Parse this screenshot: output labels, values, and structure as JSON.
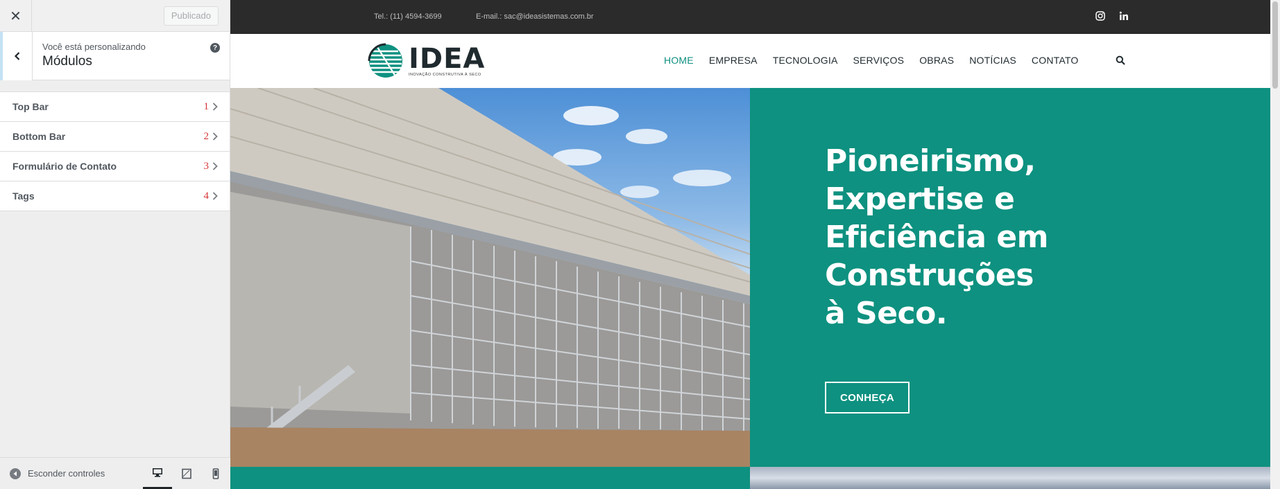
{
  "customizer": {
    "close_glyph": "✕",
    "publish_label": "Publicado",
    "section_subtitle": "Você está personalizando",
    "section_title": "Módulos",
    "help_glyph": "?",
    "items": [
      {
        "label": "Top Bar",
        "number": "1"
      },
      {
        "label": "Bottom Bar",
        "number": "2"
      },
      {
        "label": "Formulário de Contato",
        "number": "3"
      },
      {
        "label": "Tags",
        "number": "4"
      }
    ],
    "footer": {
      "hide_label": "Esconder controles",
      "devices": [
        "desktop-icon",
        "tablet-icon",
        "mobile-icon"
      ],
      "active_device": "desktop"
    }
  },
  "site": {
    "topbar": {
      "tel": "Tel.: (11) 4594-3699",
      "email": "E-mail.: sac@ideasistemas.com.br",
      "social": [
        "instagram-icon",
        "linkedin-icon"
      ]
    },
    "logo": {
      "name": "IDEA",
      "tagline": "INOVAÇÃO CONSTRUTIVA À SECO"
    },
    "menu": [
      "HOME",
      "EMPRESA",
      "TECNOLOGIA",
      "SERVIÇOS",
      "OBRAS",
      "NOTÍCIAS",
      "CONTATO"
    ],
    "active_menu": "HOME",
    "hero": {
      "heading": "Pioneirismo, Expertise e Eficiência em Construções à Seco.",
      "button": "CONHEÇA"
    }
  },
  "colors": {
    "brand_teal": "#0e9180",
    "topbar_bg": "#2b2b2b",
    "number_red": "#d63638"
  }
}
